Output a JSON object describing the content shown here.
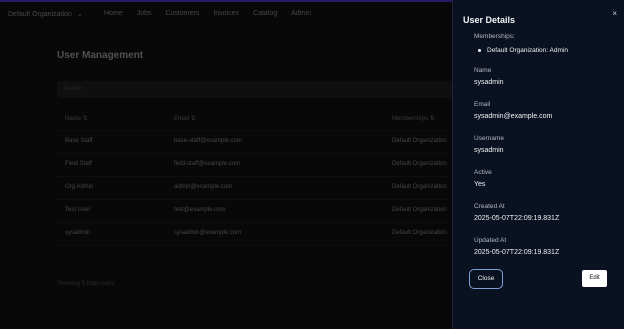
{
  "app": {
    "org_selector": "Default Organization",
    "nav": [
      "Home",
      "Jobs",
      "Customers",
      "Invoices",
      "Catalog",
      "Admin"
    ]
  },
  "page": {
    "title": "User Management",
    "search_placeholder": "Search",
    "columns": [
      "Name ⇅",
      "Email ⇅",
      "Memberships ⇅"
    ],
    "rows": [
      {
        "name": "Base Staff",
        "email": "base-staff@example.com",
        "membership": "Default Organization"
      },
      {
        "name": "Field Staff",
        "email": "field-staff@example.com",
        "membership": "Default Organization"
      },
      {
        "name": "Org Admin",
        "email": "admin@example.com",
        "membership": "Default Organization"
      },
      {
        "name": "Test User",
        "email": "test@example.com",
        "membership": "Default Organization"
      },
      {
        "name": "sysadmin",
        "email": "sysadmin@example.com",
        "membership": "Default Organization"
      }
    ],
    "footer": "Showing 5 total users"
  },
  "details": {
    "title": "User Details",
    "memberships_label": "Memberships:",
    "memberships": [
      "Default Organization: Admin"
    ],
    "name_label": "Name",
    "name": "sysadmin",
    "email_label": "Email",
    "email": "sysadmin@example.com",
    "username_label": "Username",
    "username": "sysadmin",
    "active_label": "Active",
    "active": "Yes",
    "created_label": "Created At",
    "created": "2025-05-07T22:09:19.831Z",
    "updated_label": "Updated At",
    "updated": "2025-05-07T22:09:19.831Z",
    "close_button": "Close",
    "edit_button": "Edit",
    "close_icon": "×"
  }
}
